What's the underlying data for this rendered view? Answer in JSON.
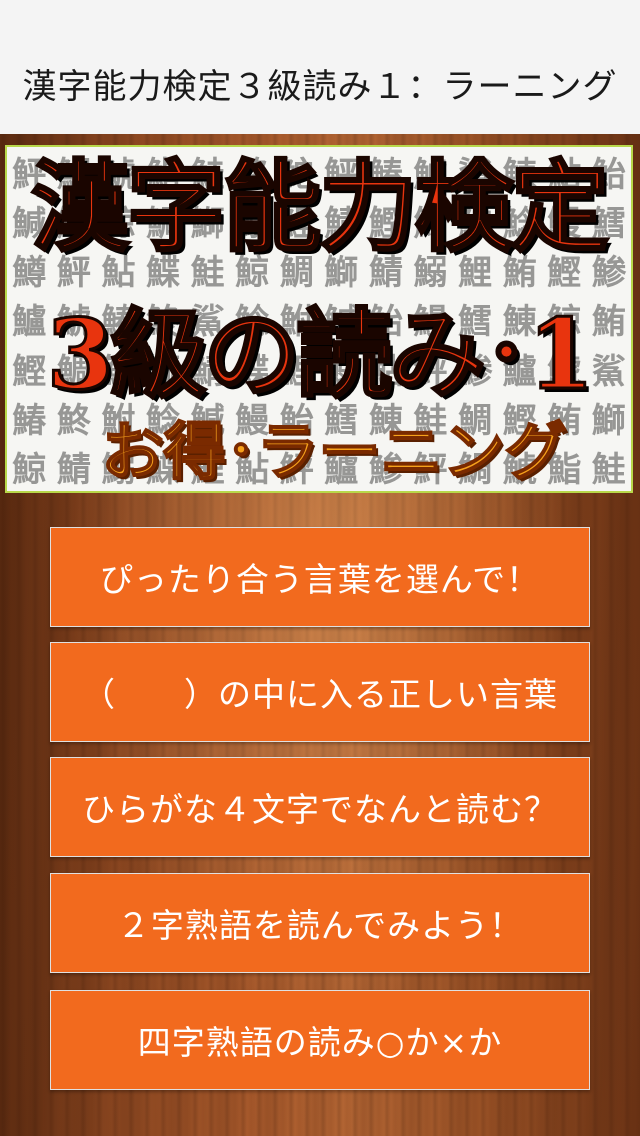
{
  "header": {
    "title": "漢字能力検定３級読み１：ラーニング"
  },
  "banner": {
    "line1": "漢字能力検定",
    "line2": "3級の読み･1",
    "line3": "お得･ラーニング",
    "background_glyphs": "鮃鯛鯱鮨鮭鮗鮀鮃鰆鯱鯊鯟鮎鮐鰔鮒鯨鯛鰤鰯鯉鯖鰹鮪鮫鯰鰻鱈鱒鮃鮎鰈鮭鯨鯛鰤鯖鰯鯉鮪鰹鯵鱸鯱鰆鮗鯊鯰鮒鰔鮐鰻鱈鯟鯨鮪鰹鯛鮭鰤鯖鰈鯉鰯鮎鮃鯵鱸鯱鯊鰆鮗鮒鯰鰔鰻鮐鱈鯟鮭鯛鰹鮪鰤鯨鯖鰯鰈鯉鮎鮃鱸鯵"
  },
  "menu": {
    "items": [
      {
        "label": "ぴったり合う言葉を選んで！"
      },
      {
        "label": "（　　）の中に入る正しい言葉"
      },
      {
        "label": "ひらがな４文字でなんと読む？"
      },
      {
        "label": "２字熟語を読んでみよう！"
      },
      {
        "label": "四字熟語の読み○か×か"
      }
    ]
  },
  "colors": {
    "button_bg": "#f26a1e",
    "banner_main_text": "#e8340e",
    "banner_sub_text": "#f7a21b",
    "banner_border": "#b8d84a",
    "wood": "#a85a2c"
  }
}
